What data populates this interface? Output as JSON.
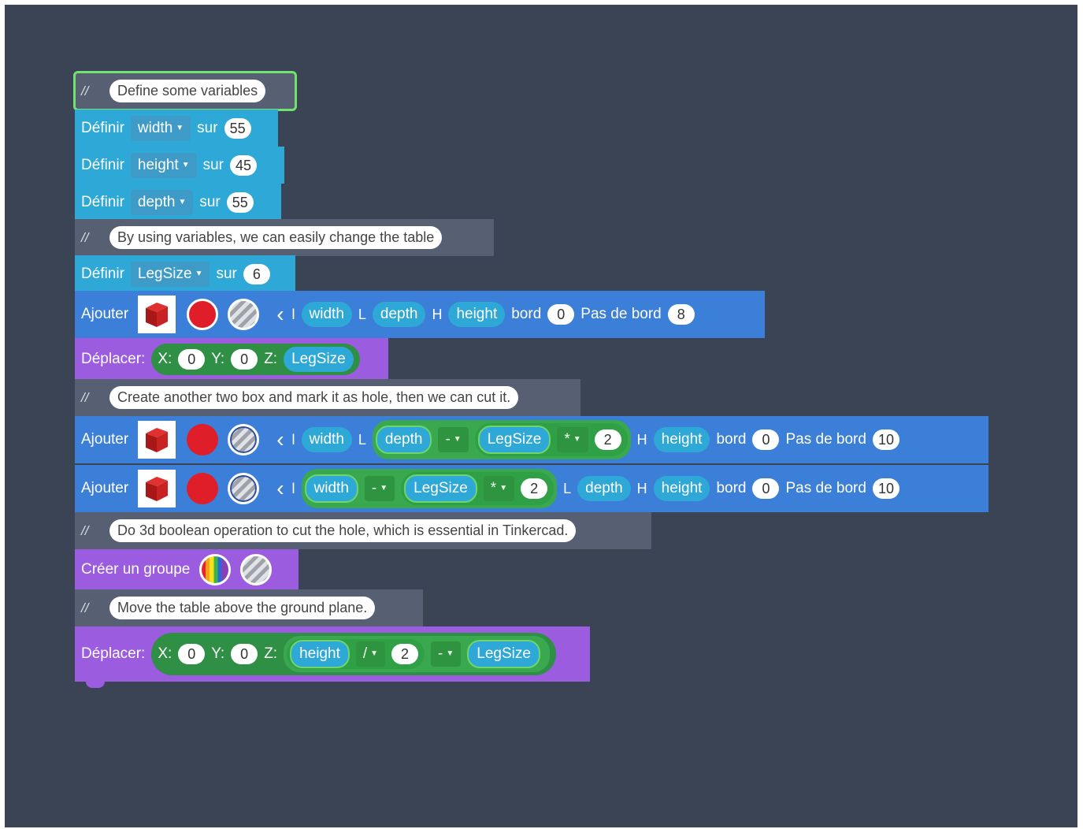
{
  "workspace": {
    "comment1": {
      "slash": "//",
      "text": "Define some variables"
    },
    "set_width": {
      "label": "Définir",
      "var": "width",
      "sur": "sur",
      "value": "55"
    },
    "set_height": {
      "label": "Définir",
      "var": "height",
      "sur": "sur",
      "value": "45"
    },
    "set_depth": {
      "label": "Définir",
      "var": "depth",
      "sur": "sur",
      "value": "55"
    },
    "comment2": {
      "slash": "//",
      "text": "By using variables, we can easily change the table"
    },
    "set_legsize": {
      "label": "Définir",
      "var": "LegSize",
      "sur": "sur",
      "value": "6"
    },
    "add1": {
      "label": "Ajouter",
      "l_label": "l",
      "l_var": "width",
      "L_label": "L",
      "L_var": "depth",
      "H_label": "H",
      "H_var": "height",
      "bord_label": "bord",
      "bord_value": "0",
      "pas_label": "Pas de bord",
      "pas_value": "8"
    },
    "move1": {
      "label": "Déplacer:",
      "x_label": "X:",
      "x_value": "0",
      "y_label": "Y:",
      "y_value": "0",
      "z_label": "Z:",
      "z_var": "LegSize"
    },
    "comment3": {
      "slash": "//",
      "text": "Create another two box and mark it as hole, then we can cut it."
    },
    "add2": {
      "label": "Ajouter",
      "l_label": "l",
      "l_var": "width",
      "L_label": "L",
      "L_expr": {
        "var1": "depth",
        "op1": "-",
        "var2": "LegSize",
        "op2": "*",
        "num": "2"
      },
      "H_label": "H",
      "H_var": "height",
      "bord_label": "bord",
      "bord_value": "0",
      "pas_label": "Pas de bord",
      "pas_value": "10"
    },
    "add3": {
      "label": "Ajouter",
      "l_label": "l",
      "l_expr": {
        "var1": "width",
        "op1": "-",
        "var2": "LegSize",
        "op2": "*",
        "num": "2"
      },
      "L_label": "L",
      "L_var": "depth",
      "H_label": "H",
      "H_var": "height",
      "bord_label": "bord",
      "bord_value": "0",
      "pas_label": "Pas de bord",
      "pas_value": "10"
    },
    "comment4": {
      "slash": "//",
      "text": "Do 3d boolean operation to cut the hole, which is essential in Tinkercad."
    },
    "group": {
      "label": "Créer un groupe"
    },
    "comment5": {
      "slash": "//",
      "text": "Move the table above the ground plane."
    },
    "move2": {
      "label": "Déplacer:",
      "x_label": "X:",
      "x_value": "0",
      "y_label": "Y:",
      "y_value": "0",
      "z_label": "Z:",
      "z_expr": {
        "var1": "height",
        "op1": "/",
        "num": "2",
        "op2": "-",
        "var2": "LegSize"
      }
    }
  },
  "icons": {
    "shape": "red-box-icon",
    "color": "red-color-icon",
    "hole": "hole-icon",
    "multicolor": "rainbow-color-icon",
    "chevron": "chevron-left-icon",
    "dropdown": "caret-down-icon"
  },
  "colors": {
    "workspace": "#3b4455",
    "comment": "#566072",
    "variable": "#2ea8d6",
    "add": "#3c7fd9",
    "move": "#9b5ce0",
    "math": "#3aa84f",
    "selection": "#72e26f"
  }
}
